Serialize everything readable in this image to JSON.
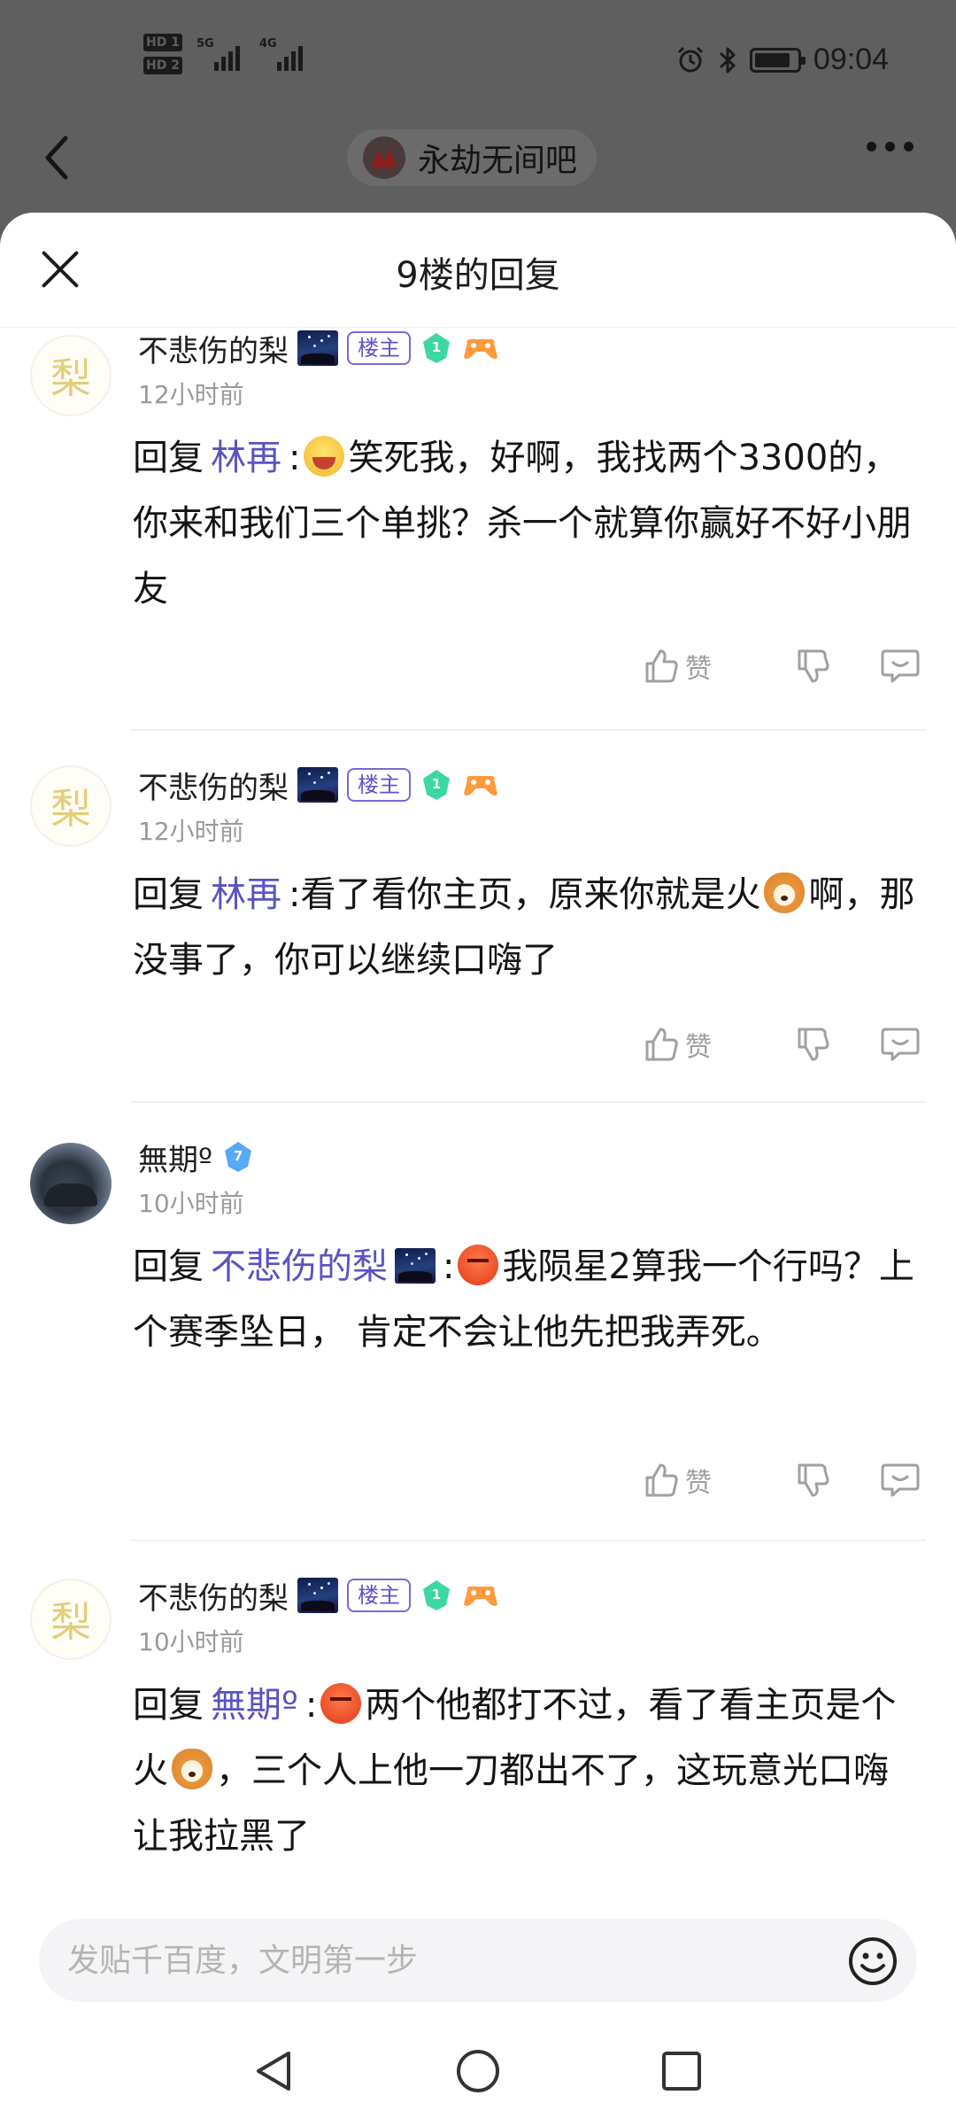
{
  "status": {
    "sim1": "HD 1",
    "sim2": "HD 2",
    "net1": "5G",
    "net2": "4G",
    "time": "09:04",
    "battery_level": 0.85
  },
  "header": {
    "forum_name": "永劫无间吧"
  },
  "sheet": {
    "title": "9楼的回复"
  },
  "replies": [
    {
      "username": "不悲伤的梨",
      "owner_badge": "楼主",
      "level": "1",
      "time": "12小时前",
      "reply_prefix": "回复",
      "target": "林再",
      "separator": ":",
      "text": "笑死我，好啊，我找两个3300的，你来和我们三个单挑？杀一个就算你赢好不好小朋友",
      "like_label": "赞"
    },
    {
      "username": "不悲伤的梨",
      "owner_badge": "楼主",
      "level": "1",
      "time": "12小时前",
      "reply_prefix": "回复",
      "target": "林再",
      "separator": ":",
      "text_a": "看了看你主页，原来你就是火",
      "text_b": "啊，那没事了，你可以继续口嗨了",
      "like_label": "赞"
    },
    {
      "username": "無期º",
      "level": "7",
      "time": "10小时前",
      "reply_prefix": "回复",
      "target": "不悲伤的梨",
      "separator": ":",
      "text": "我陨星2算我一个行吗？上个赛季坠日， 肯定不会让他先把我弄死。",
      "like_label": "赞"
    },
    {
      "username": "不悲伤的梨",
      "owner_badge": "楼主",
      "level": "1",
      "time": "10小时前",
      "reply_prefix": "回复",
      "target": "無期º",
      "separator": ":",
      "text_a": "两个他都打不过，看了看主页是个火",
      "text_b": "，三个人上他一刀都出不了，这玩意光口嗨让我拉黑了",
      "like_label": "赞"
    }
  ],
  "avatar_char": "梨",
  "input": {
    "placeholder": "发贴千百度，文明第一步"
  },
  "colors": {
    "accent": "#5a52c2",
    "owner_badge": "#6451c7",
    "overlay": "#5f5f5f"
  },
  "icons": [
    "back-icon",
    "more-icon",
    "close-icon",
    "thumbs-up-icon",
    "thumbs-down-icon",
    "comment-icon",
    "emoji-icon",
    "nav-back-icon",
    "nav-home-icon",
    "nav-recents-icon"
  ]
}
